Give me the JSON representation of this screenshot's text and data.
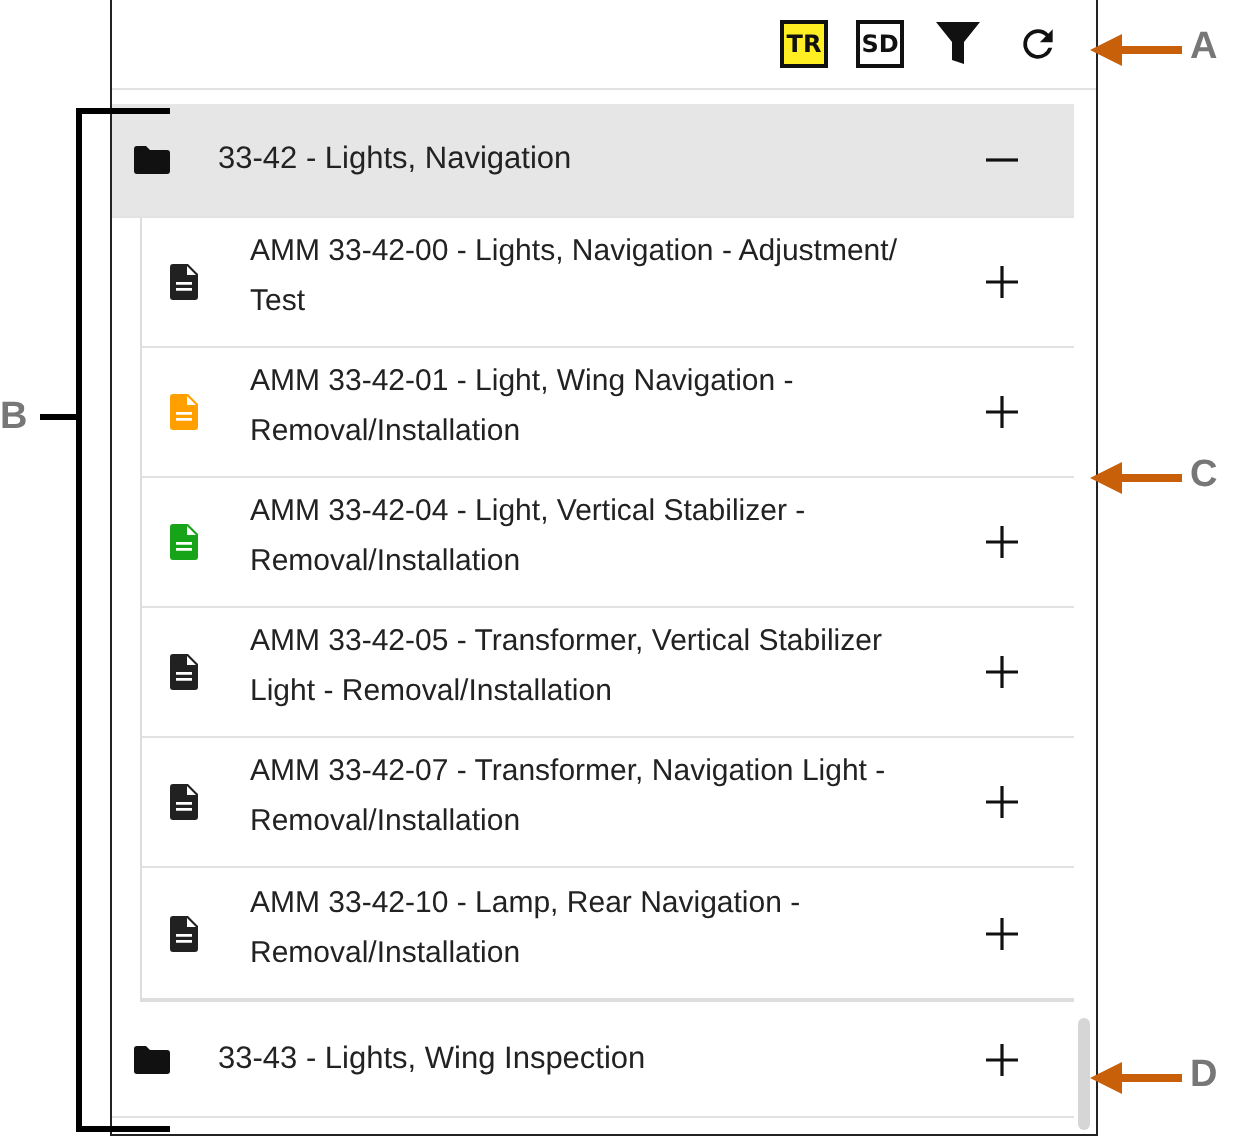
{
  "toolbar": {
    "buttons": [
      {
        "kind": "badge",
        "label": "TR",
        "highlighted": true
      },
      {
        "kind": "badge",
        "label": "SD",
        "highlighted": false
      },
      {
        "kind": "filter"
      },
      {
        "kind": "refresh"
      }
    ]
  },
  "tree": [
    {
      "label": "33-42 - Lights, Navigation",
      "expanded": true,
      "children": [
        {
          "label": "AMM 33-42-00 - Lights, Navigation - Adjustment/ Test",
          "color": "#212121",
          "expanded": false
        },
        {
          "label": "AMM 33-42-01 - Light, Wing Navigation - Removal/Installation",
          "color": "#ffa000",
          "expanded": false
        },
        {
          "label": "AMM 33-42-04 - Light, Vertical Stabilizer - Removal/Installation",
          "color": "#18a418",
          "expanded": false
        },
        {
          "label": "AMM 33-42-05 - Transformer, Vertical Stabilizer Light - Removal/Installation",
          "color": "#212121",
          "expanded": false
        },
        {
          "label": "AMM 33-42-07 - Transformer, Navigation Light - Removal/Installation",
          "color": "#212121",
          "expanded": false
        },
        {
          "label": "AMM 33-42-10 - Lamp, Rear Navigation - Removal/Installation",
          "color": "#212121",
          "expanded": false
        }
      ]
    },
    {
      "label": "33-43 - Lights, Wing Inspection",
      "expanded": false
    }
  ],
  "callouts": [
    {
      "kind": "arrow",
      "label": "A"
    },
    {
      "kind": "bracket",
      "label": "B"
    },
    {
      "kind": "arrow",
      "label": "C"
    },
    {
      "kind": "arrow",
      "label": "D"
    }
  ]
}
